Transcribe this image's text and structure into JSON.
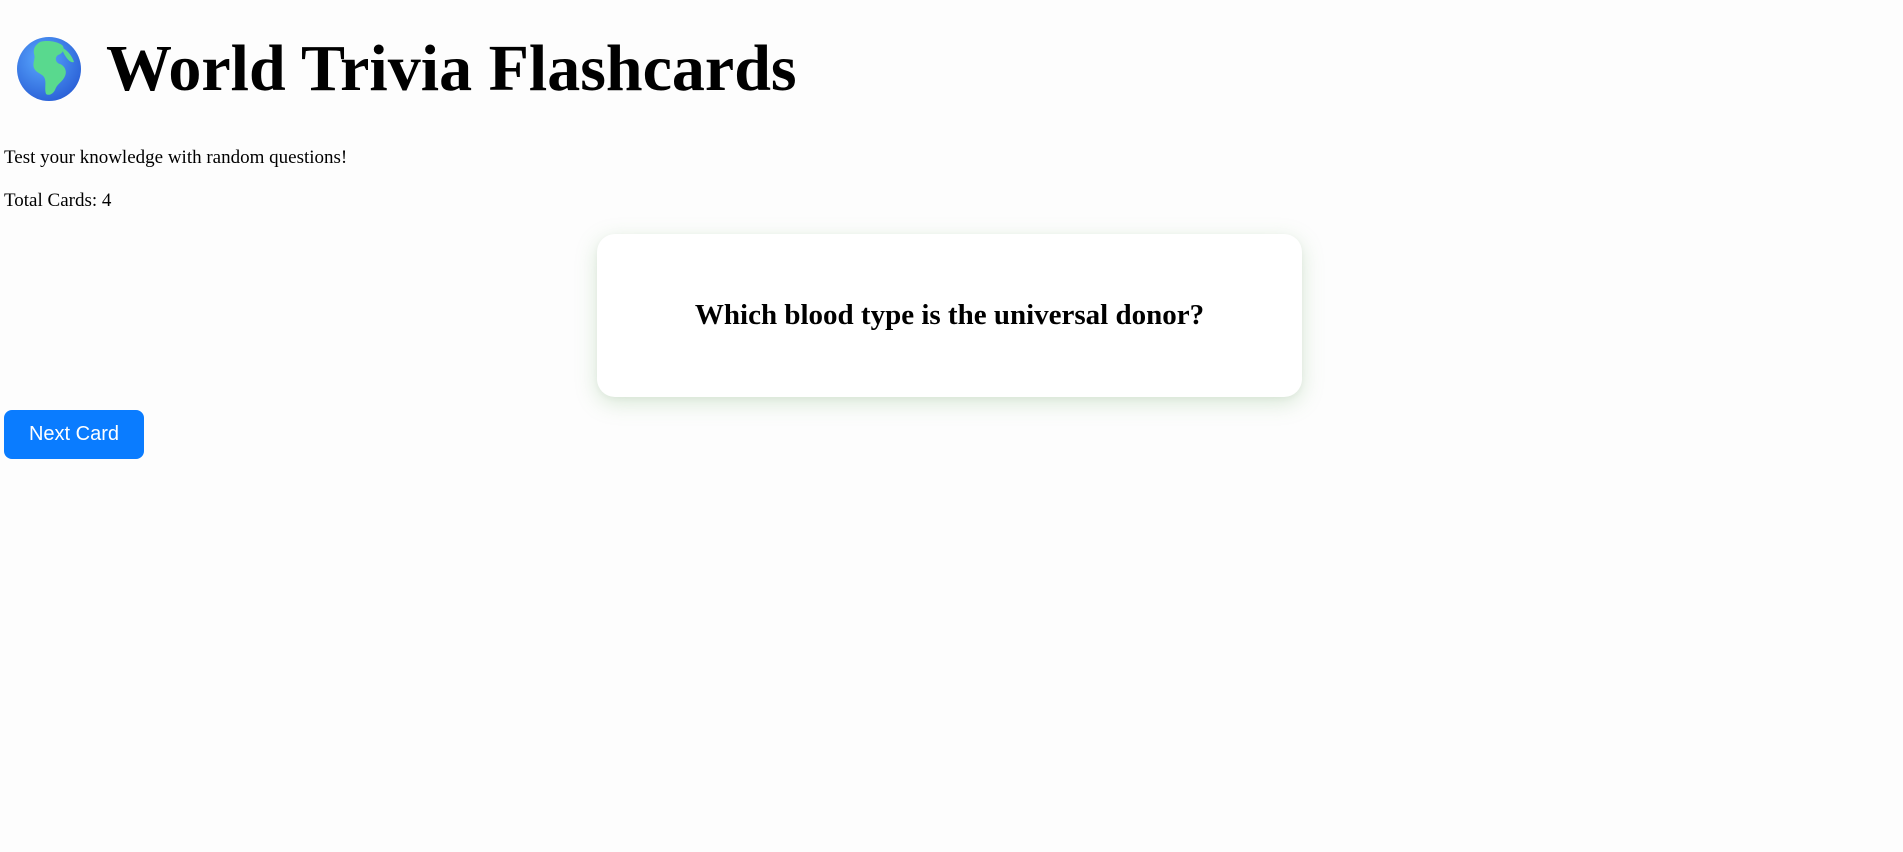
{
  "header": {
    "icon": "globe-europe-africa-icon",
    "title": "World Trivia Flashcards"
  },
  "intro": {
    "subtitle": "Test your knowledge with random questions!",
    "total_cards": "Total Cards: 4"
  },
  "card": {
    "question": "Which blood type is the universal donor?"
  },
  "controls": {
    "next_label": "Next Card"
  },
  "colors": {
    "button": "#0a7cff",
    "card_shadow": "#78b46e",
    "background": "#fdfdfd"
  }
}
